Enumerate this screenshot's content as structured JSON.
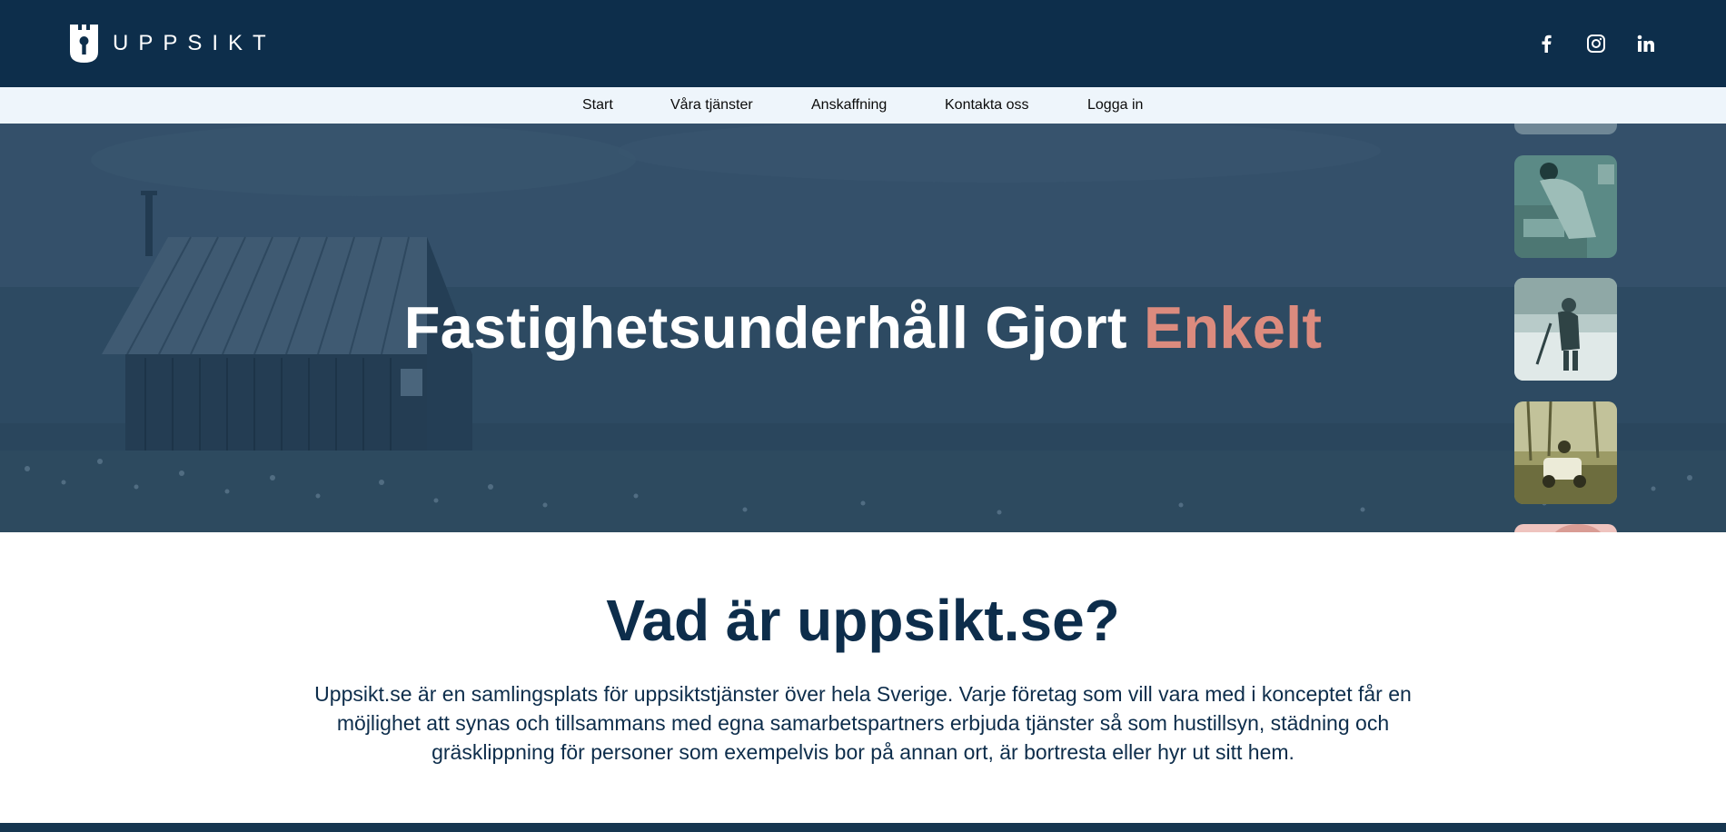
{
  "brand": {
    "name": "UPPSIKT"
  },
  "social": [
    {
      "icon": "facebook-icon"
    },
    {
      "icon": "instagram-icon"
    },
    {
      "icon": "linkedin-icon"
    }
  ],
  "nav": {
    "items": [
      {
        "label": "Start"
      },
      {
        "label": "Våra tjänster"
      },
      {
        "label": "Anskaffning"
      },
      {
        "label": "Kontakta oss"
      },
      {
        "label": "Logga in"
      }
    ]
  },
  "hero": {
    "title_main": "Fastighetsunderhåll Gjort",
    "title_accent": "Enkelt"
  },
  "about": {
    "title": "Vad är uppsikt.se?",
    "text": "Uppsikt.se är en samlingsplats för uppsiktstjänster över hela Sverige. Varje företag som vill vara med i konceptet får en möjlighet att synas och tillsammans med egna samarbetspartners erbjuda tjänster så som hustillsyn, städning och gräsklippning för personer som exempelvis bor på annan ort, är bortresta eller hyr ut sitt hem."
  },
  "colors": {
    "header_bg": "#0d2e4b",
    "nav_bg": "#eef5fb",
    "accent": "#dc8b7e",
    "text_dark": "#0d2d4b"
  }
}
